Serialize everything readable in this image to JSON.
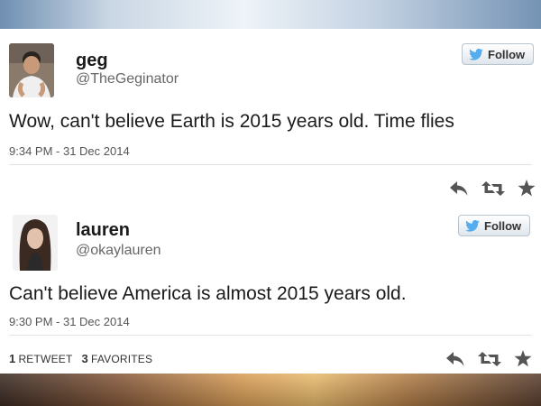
{
  "tweets": [
    {
      "name": "geg",
      "handle": "@TheGeginator",
      "follow_label": "Follow",
      "text": "Wow, can't believe Earth is 2015 years old. Time flies",
      "timestamp": "9:34 PM - 31 Dec 2014"
    },
    {
      "name": "lauren",
      "handle": "@okaylauren",
      "follow_label": "Follow",
      "text": "Can't believe America is almost 2015 years old.",
      "timestamp": "9:30 PM - 31 Dec 2014",
      "retweets": {
        "count": "1",
        "label": "RETWEET"
      },
      "favorites": {
        "count": "3",
        "label": "FAVORITES"
      }
    }
  ],
  "colors": {
    "twitter_bird": "#55acee",
    "action_icons": "#555555"
  },
  "icons": [
    "bird-icon",
    "reply-icon",
    "retweet-icon",
    "favorite-icon"
  ]
}
